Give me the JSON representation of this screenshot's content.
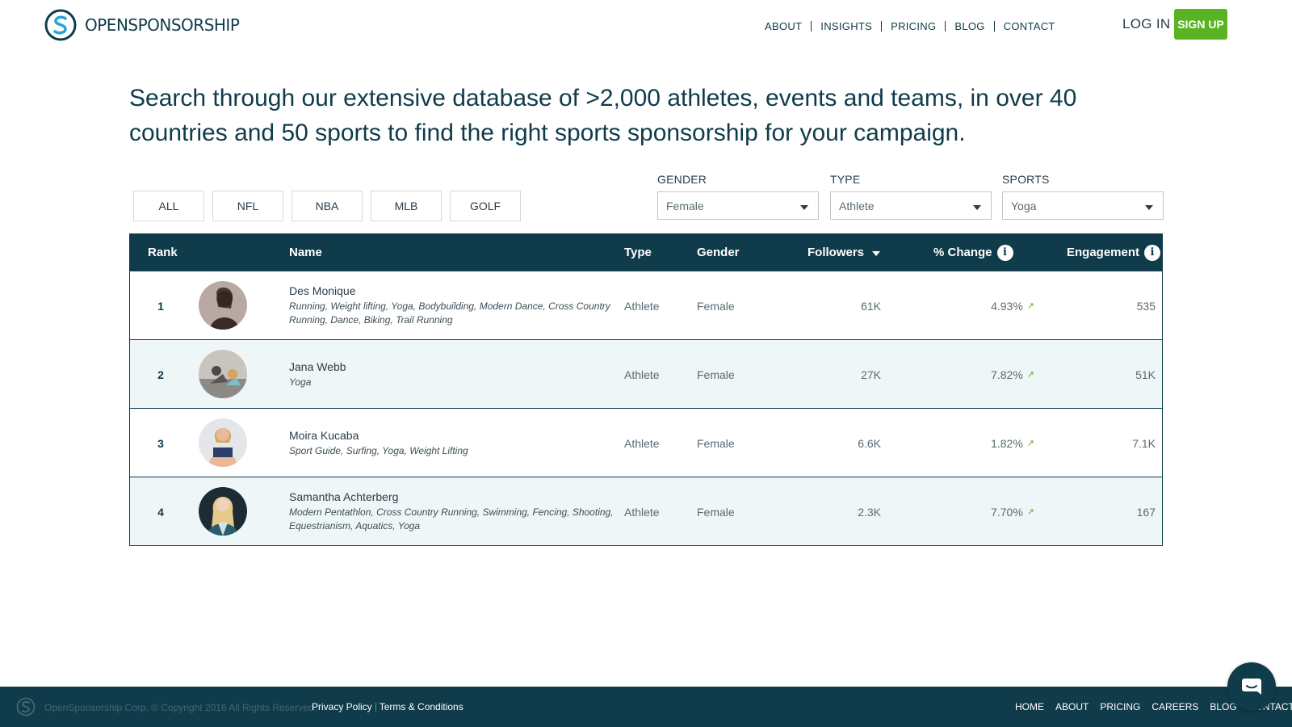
{
  "header": {
    "logo_text": "OPENSPONSORSHIP",
    "nav": [
      "ABOUT",
      "INSIGHTS",
      "PRICING",
      "BLOG",
      "CONTACT"
    ],
    "login": "LOG IN",
    "signup": "SIGN UP"
  },
  "intro": {
    "text": "Search through our extensive database of >2,000 athletes, events and teams, in over 40 countries and 50 sports to find the right sports sponsorship for your campaign."
  },
  "tabs": [
    "ALL",
    "NFL",
    "NBA",
    "MLB",
    "GOLF"
  ],
  "filters": {
    "gender": {
      "label": "GENDER",
      "value": "Female"
    },
    "type": {
      "label": "TYPE",
      "value": "Athlete"
    },
    "sports": {
      "label": "SPORTS",
      "value": "Yoga"
    }
  },
  "table": {
    "columns": {
      "rank": "Rank",
      "name": "Name",
      "type": "Type",
      "gender": "Gender",
      "followers": "Followers",
      "change": "% Change",
      "engagement": "Engagement"
    },
    "rows": [
      {
        "rank": "1",
        "name": "Des Monique",
        "sports": "Running, Weight lifting, Yoga, Bodybuilding, Modern Dance, Cross Country Running, Dance, Biking, Trail Running",
        "type": "Athlete",
        "gender": "Female",
        "followers": "61K",
        "change": "4.93%",
        "engagement": "535"
      },
      {
        "rank": "2",
        "name": "Jana Webb",
        "sports": "Yoga",
        "type": "Athlete",
        "gender": "Female",
        "followers": "27K",
        "change": "7.82%",
        "engagement": "51K"
      },
      {
        "rank": "3",
        "name": "Moira Kucaba",
        "sports": "Sport Guide, Surfing, Yoga, Weight Lifting",
        "type": "Athlete",
        "gender": "Female",
        "followers": "6.6K",
        "change": "1.82%",
        "engagement": "7.1K"
      },
      {
        "rank": "4",
        "name": "Samantha Achterberg",
        "sports": "Modern Pentathlon, Cross Country Running, Swimming, Fencing, Shooting, Equestrianism, Aquatics, Yoga",
        "type": "Athlete",
        "gender": "Female",
        "followers": "2.3K",
        "change": "7.70%",
        "engagement": "167"
      }
    ]
  },
  "footer": {
    "copyright": "OpenSponsorship Corp. © Copyright 2016 All Rights Reserved.",
    "privacy": "Privacy Policy",
    "terms": "Terms & Conditions",
    "nav": [
      "HOME",
      "ABOUT",
      "PRICING",
      "CAREERS",
      "BLOG",
      "CONTACT"
    ]
  },
  "colors": {
    "brand_dark": "#0f3b4a",
    "accent_green": "#5ab323",
    "row_alt": "#eef6f7"
  }
}
